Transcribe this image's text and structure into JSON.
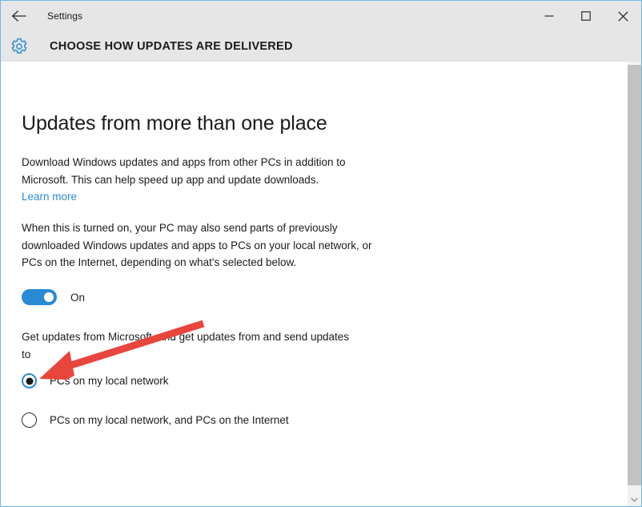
{
  "window": {
    "app_title": "Settings",
    "back_icon": "back-arrow-icon",
    "minimize_icon": "minimize-icon",
    "maximize_icon": "maximize-icon",
    "close_icon": "close-icon"
  },
  "header": {
    "gear_icon": "gear-icon",
    "page_title": "CHOOSE HOW UPDATES ARE DELIVERED"
  },
  "main": {
    "heading": "Updates from more than one place",
    "paragraph_1": "Download Windows updates and apps from other PCs in addition to Microsoft. This can help speed up app and update downloads.",
    "learn_more": "Learn more",
    "paragraph_2": "When this is turned on, your PC may also send parts of previously downloaded Windows updates and apps to PCs on your local network, or PCs on the Internet, depending on what's selected below.",
    "toggle": {
      "state": "On",
      "label": "On",
      "checked": true
    },
    "paragraph_3": "Get updates from Microsoft, and get updates from and send updates to",
    "radio_options": [
      {
        "label": "PCs on my local network",
        "checked": true
      },
      {
        "label": "PCs on my local network, and PCs on the Internet",
        "checked": false
      }
    ]
  },
  "scrollbar": {
    "up_icon": "chevron-up-icon",
    "down_icon": "chevron-down-icon",
    "thumb": "scrollbar-thumb"
  },
  "annotation": {
    "arrow_color": "#e8453c",
    "type": "arrow-pointing-to-selected-radio"
  },
  "colors": {
    "accent": "#2a8ad4",
    "window_border": "#6cb8e6",
    "chrome": "#e6e6e6",
    "text": "#1b1b1b",
    "link": "#2a8ad4",
    "scrollbar_track": "#f1f1f1",
    "scrollbar_thumb": "#c2c2c2"
  }
}
